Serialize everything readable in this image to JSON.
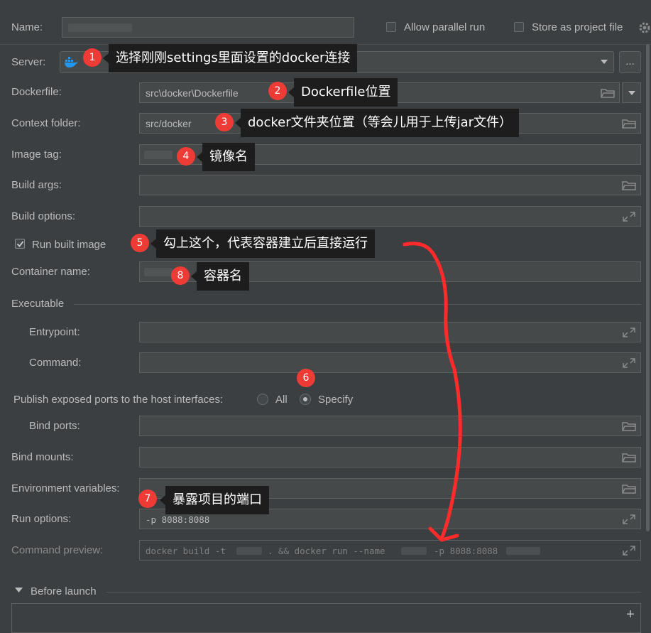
{
  "form": {
    "name_label": "Name:",
    "name_value": "",
    "allow_parallel_run": "Allow parallel run",
    "store_as_project_file": "Store as project file",
    "server_label": "Server:",
    "server_more_button": "...",
    "dockerfile_label": "Dockerfile:",
    "dockerfile_value": "src\\docker\\Dockerfile",
    "context_folder_label": "Context folder:",
    "context_folder_value": "src/docker",
    "image_tag_label": "Image tag:",
    "build_args_label": "Build args:",
    "build_options_label": "Build options:",
    "run_built_image": "Run built image",
    "container_name_label": "Container name:",
    "executable_section": "Executable",
    "entrypoint_label": "Entrypoint:",
    "command_label": "Command:",
    "publish_ports_label": "Publish exposed ports to the host interfaces:",
    "radio_all": "All",
    "radio_specify": "Specify",
    "bind_ports_label": "Bind ports:",
    "bind_mounts_label": "Bind mounts:",
    "env_vars_label": "Environment variables:",
    "run_options_label": "Run options:",
    "run_options_value": "-p 8088:8088",
    "command_preview_label": "Command preview:",
    "command_preview_part1": "docker build -t",
    "command_preview_part2": ". && docker run --name",
    "command_preview_part3": "-p 8088:8088",
    "before_launch": "Before launch",
    "add_button": "+"
  },
  "annotations": [
    {
      "number": "1",
      "text": "选择刚刚settings里面设置的docker连接"
    },
    {
      "number": "2",
      "text": "Dockerfile位置"
    },
    {
      "number": "3",
      "text": "docker文件夹位置（等会儿用于上传jar文件）"
    },
    {
      "number": "4",
      "text": "镜像名"
    },
    {
      "number": "5",
      "text": "勾上这个，代表容器建立后直接运行"
    },
    {
      "number": "6",
      "text": ""
    },
    {
      "number": "7",
      "text": "暴露项目的端口"
    },
    {
      "number": "8",
      "text": "容器名"
    }
  ],
  "colors": {
    "background": "#3c3f41",
    "field": "#45494a",
    "badge": "#ef3b36",
    "callout": "#1d1d1d",
    "arrow": "#ff2a2a"
  }
}
